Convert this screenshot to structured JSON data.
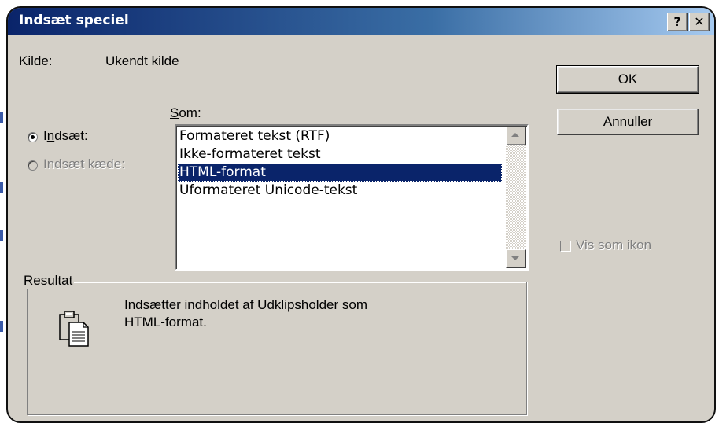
{
  "dialog": {
    "title": "Indsæt speciel",
    "help_button": "?",
    "close_button": "✕"
  },
  "source": {
    "label": "Kilde:",
    "value": "Ukendt kilde"
  },
  "as_label": "Som:",
  "paste_options": [
    {
      "label": "Indsæt:",
      "selected": true,
      "enabled": true
    },
    {
      "label": "Indsæt kæde:",
      "selected": false,
      "enabled": false
    }
  ],
  "formats": [
    {
      "label": "Formateret tekst (RTF)",
      "selected": false
    },
    {
      "label": "Ikke-formateret tekst",
      "selected": false
    },
    {
      "label": "HTML-format",
      "selected": true
    },
    {
      "label": "Uformateret Unicode-tekst",
      "selected": false
    }
  ],
  "buttons": {
    "ok": "OK",
    "cancel": "Annuller"
  },
  "display_as_icon": {
    "label": "Vis som ikon",
    "checked": false,
    "enabled": false
  },
  "result": {
    "label": "Resultat",
    "text_line1": "Indsætter indholdet af Udklipsholder som",
    "text_line2": "HTML-format.",
    "icon": "clipboard-icon"
  },
  "colors": {
    "titlebar": "#0a246a",
    "selection": "#0a246a",
    "face": "#d4d0c8"
  }
}
